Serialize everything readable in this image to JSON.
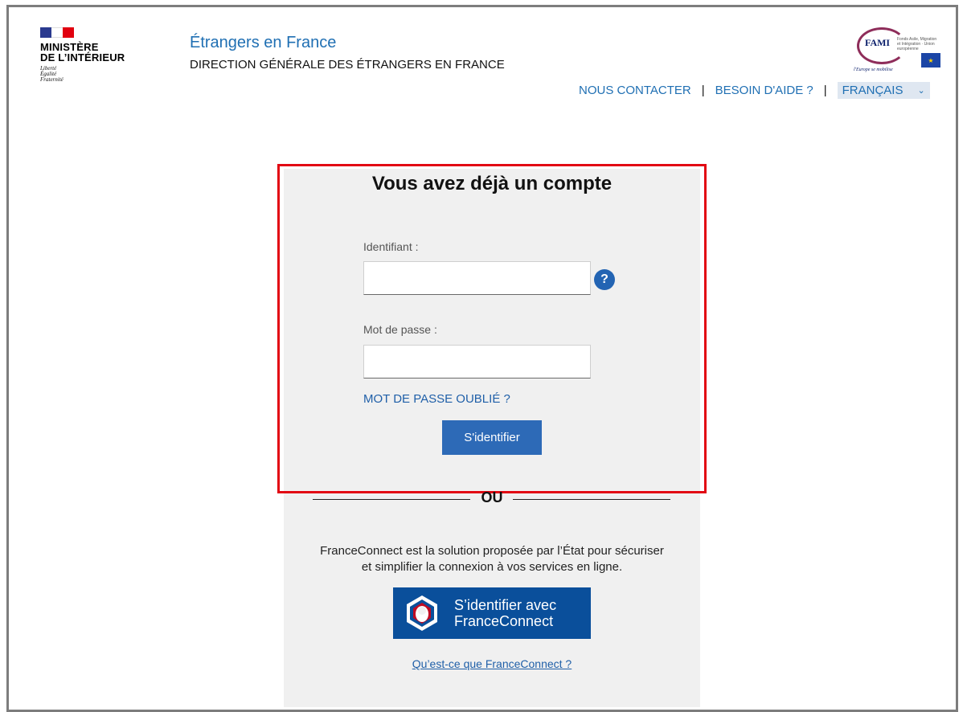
{
  "header": {
    "ministry_line1": "MINISTÈRE",
    "ministry_line2": "DE L’INTÉRIEUR",
    "motto_1": "Liberté",
    "motto_2": "Égalité",
    "motto_3": "Fraternité",
    "site_title": "Étrangers en France",
    "site_subtitle": "DIRECTION GÉNÉRALE DES ÉTRANGERS EN FRANCE",
    "fami_logo_text": "FAMI",
    "fami_small_text": "Fonds Asile, Migration et Intégration · Union européenne",
    "fami_slogan": "l'Europe se mobilise"
  },
  "nav": {
    "contact": "NOUS CONTACTER",
    "help": "BESOIN D'AIDE ?",
    "separator": "|",
    "language": "FRANÇAIS"
  },
  "login": {
    "title": "Vous avez déjà un compte",
    "id_label": "Identifiant :",
    "id_value": "",
    "password_label": "Mot de passe :",
    "password_value": "",
    "help_glyph": "?",
    "forgot": "MOT DE PASSE OUBLIÉ ?",
    "submit": "S'identifier"
  },
  "divider": {
    "text": "OU"
  },
  "franceconnect": {
    "description_1": "FranceConnect est la solution proposée par l’État pour sécuriser",
    "description_2": "et simplifier la connexion à vos services en ligne.",
    "button_line1": "S’identifier avec",
    "button_line2": "FranceConnect",
    "what_link": "Qu’est-ce que FranceConnect ?"
  },
  "colors": {
    "brand_blue": "#1f6fb3",
    "button_blue": "#2d6ab7",
    "franceconnect_blue": "#0a4f9b",
    "highlight_red": "#e20713"
  }
}
